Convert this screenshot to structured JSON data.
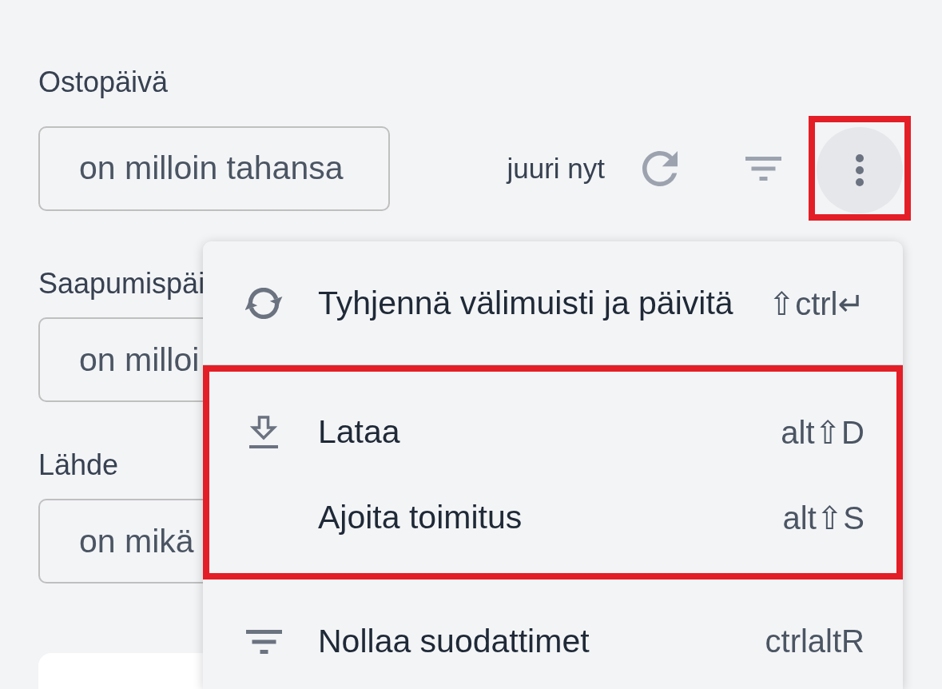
{
  "filters": [
    {
      "label": "Ostopäivä",
      "value": "on milloin tahansa"
    },
    {
      "label": "Saapumispäi",
      "value": "on milloi"
    },
    {
      "label": "Lähde",
      "value": "on mikä"
    }
  ],
  "toolbar": {
    "updated": "juuri nyt",
    "more_button": {
      "expanded": true,
      "highlighted": true
    }
  },
  "menu": {
    "sections": [
      {
        "highlighted": false,
        "items": [
          {
            "label": "Tyhjennä välimuisti ja päivitä",
            "shortcut": "⇧ctrl↵"
          }
        ]
      },
      {
        "highlighted": true,
        "items": [
          {
            "label": "Lataa",
            "shortcut": "alt⇧D"
          },
          {
            "label": "Ajoita toimitus",
            "shortcut": "alt⇧S"
          }
        ]
      },
      {
        "highlighted": false,
        "items": [
          {
            "label": "Nollaa suodattimet",
            "shortcut": "ctrlaltR"
          }
        ]
      }
    ]
  }
}
